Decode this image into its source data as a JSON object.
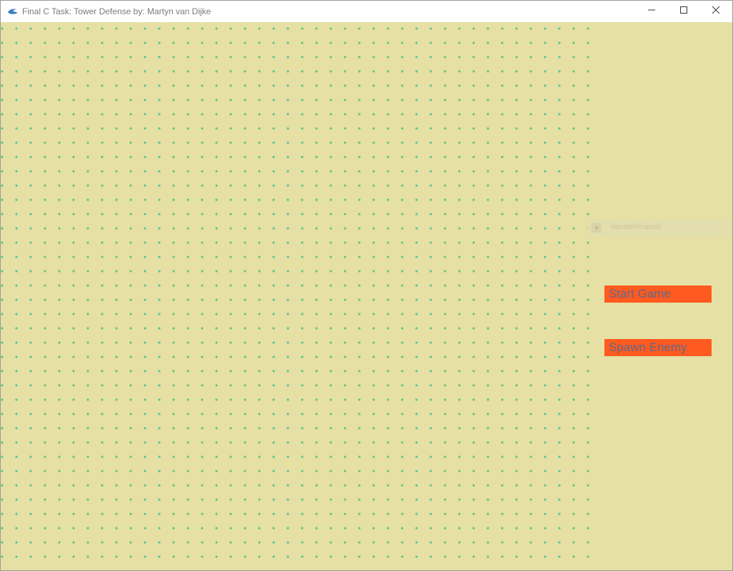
{
  "window": {
    "title": "Final C Task: Tower Defense by: Martyn van Dijke"
  },
  "controls": {
    "minimize_icon": "minimize-icon",
    "maximize_icon": "maximize-icon",
    "close_icon": "close-icon"
  },
  "snip_overlay": {
    "label": "Vensterknipsel"
  },
  "buttons": {
    "start_game": "Start Game",
    "spawn_enemy": "Spawn Enemy"
  },
  "colors": {
    "background": "#e6e0a4",
    "grid_dot": "#5fc48c",
    "button_bg": "#ff5a1f",
    "button_text": "#5f6a8a"
  }
}
